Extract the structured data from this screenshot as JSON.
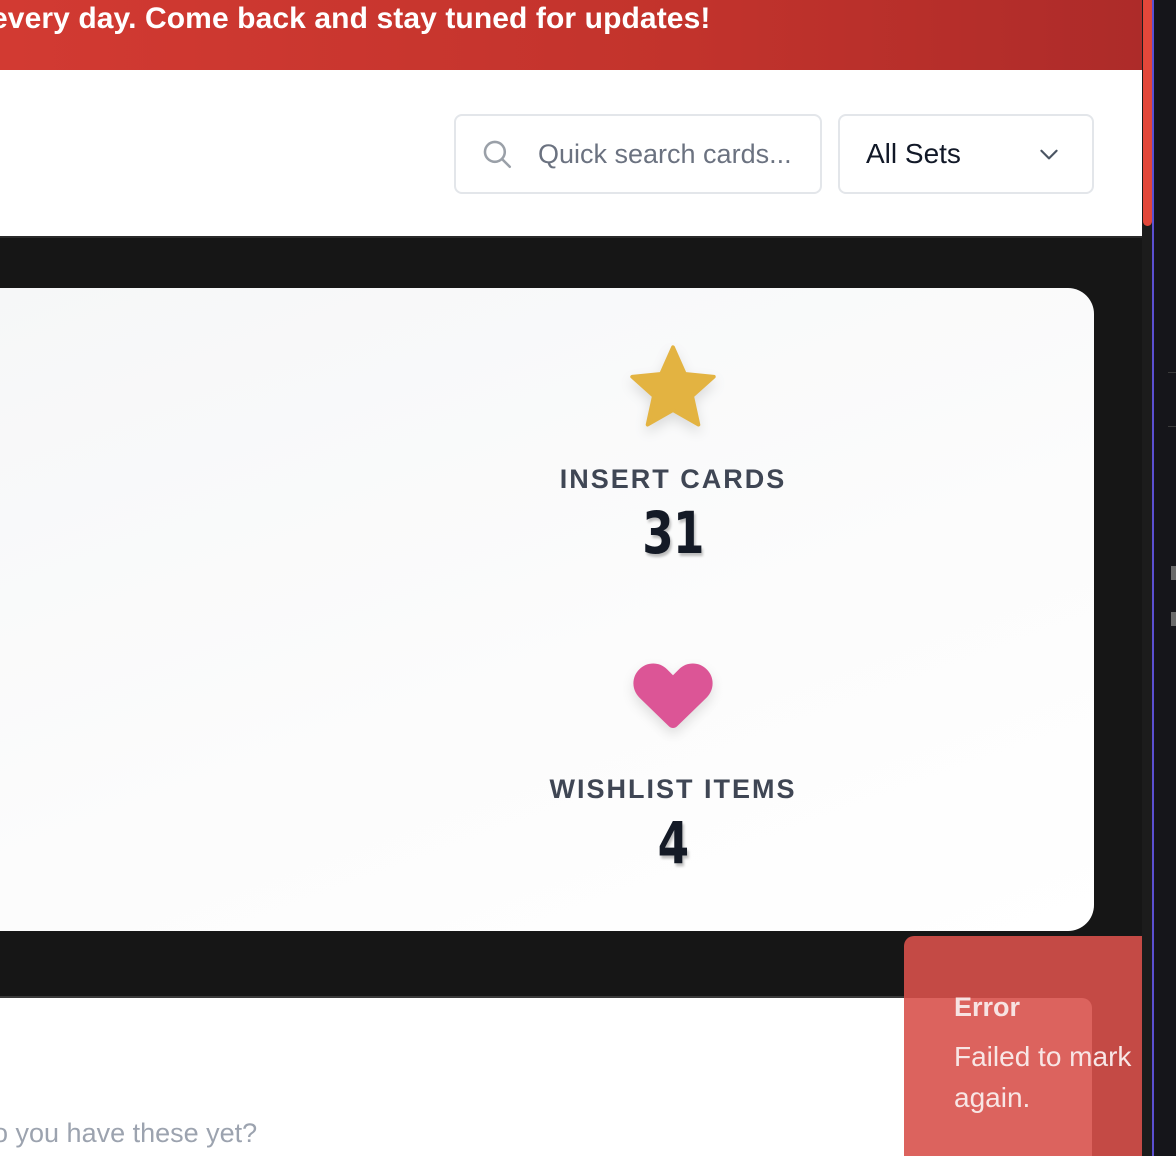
{
  "banner": {
    "text": "every day. Come back and stay tuned for updates!"
  },
  "header": {
    "search": {
      "value": "",
      "placeholder": "Quick search cards..."
    },
    "set_filter": {
      "selected": "All Sets"
    }
  },
  "stats": [
    {
      "icon": "star-icon",
      "label": "INSERT CARDS",
      "value": "31",
      "color": "#e3b341"
    },
    {
      "icon": "heart-icon",
      "label": "WISHLIST ITEMS",
      "value": "4",
      "color": "#dc5596"
    }
  ],
  "lower": {
    "prompt": "o you have these yet?"
  },
  "toast": {
    "title": "Error",
    "message": "Failed to mark again."
  },
  "colors": {
    "banner": "#c2332c",
    "accent": "#e2473a",
    "page_dark": "#161616"
  }
}
